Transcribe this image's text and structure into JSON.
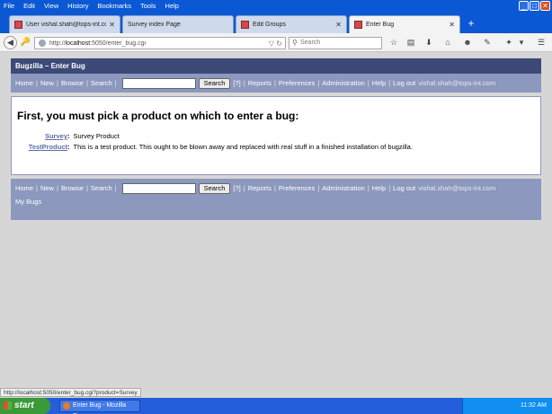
{
  "menu": [
    "File",
    "Edit",
    "View",
    "History",
    "Bookmarks",
    "Tools",
    "Help"
  ],
  "tabs": [
    {
      "title": "User vishal.shah@tops-int.co..."
    },
    {
      "title": "Survey index Page"
    },
    {
      "title": "Edit Groups"
    },
    {
      "title": "Enter Bug"
    }
  ],
  "nav": {
    "url_prefix": "http://",
    "url_host": "localhost",
    "url_rest": ":5050/enter_bug.cgi",
    "search_placeholder": "Search"
  },
  "page": {
    "header": "Bugzilla – Enter Bug",
    "links": {
      "home": "Home",
      "new": "New",
      "browse": "Browse",
      "search": "Search",
      "search_button": "Search",
      "help_q": "[?]",
      "reports": "Reports",
      "preferences": "Preferences",
      "administration": "Administration",
      "help": "Help",
      "logout": "Log out",
      "user": "vishal.shah@tops-int.com"
    },
    "heading": "First, you must pick a product on which to enter a bug:",
    "products": [
      {
        "name": "Survey",
        "desc": "Survey Product"
      },
      {
        "name": "TestProduct",
        "desc": "This is a test product. This ought to be blown away and replaced with real stuff in a finished installation of bugzilla."
      }
    ],
    "my_bugs": "My Bugs"
  },
  "status_text": "http://localhost:5050/enter_bug.cgi?product=Survey",
  "taskbar": {
    "start": "start",
    "item": "Enter Bug - Mozilla Fir...",
    "time": "11:32 AM"
  }
}
